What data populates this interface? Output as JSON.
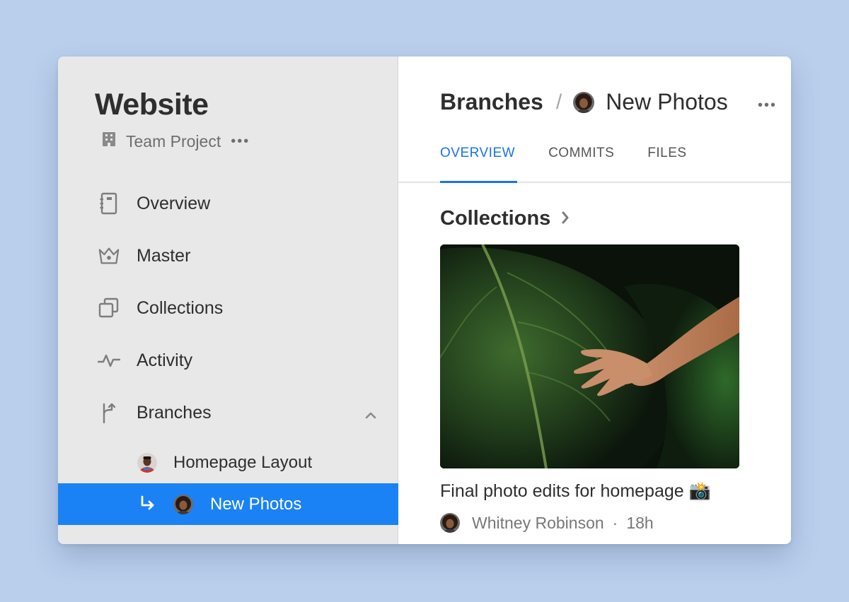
{
  "project": {
    "title": "Website",
    "subtitle": "Team Project",
    "more": "•••"
  },
  "nav": {
    "overview": "Overview",
    "master": "Master",
    "collections": "Collections",
    "activity": "Activity",
    "branches": "Branches"
  },
  "branches": [
    {
      "label": "Homepage Layout"
    },
    {
      "label": "New Photos"
    }
  ],
  "header": {
    "crumb_root": "Branches",
    "separator": "/",
    "crumb_current": "New Photos",
    "more": "•••"
  },
  "tabs": [
    "OVERVIEW",
    "COMMITS",
    "FILES"
  ],
  "collections": {
    "title": "Collections",
    "caption": "Final photo edits for homepage 📸",
    "author": "Whitney Robinson",
    "dot": "·",
    "time": "18h"
  },
  "colors": {
    "accent": "#1a82f4",
    "tab_active": "#1a73e8",
    "sidebar_bg": "#e8e8e8",
    "page_bg": "#b9cfec"
  },
  "icons": {
    "team": "building-icon",
    "overview": "notebook-icon",
    "master": "crown-icon",
    "collections": "stack-icon",
    "activity": "pulse-icon",
    "branches": "branch-icon"
  }
}
